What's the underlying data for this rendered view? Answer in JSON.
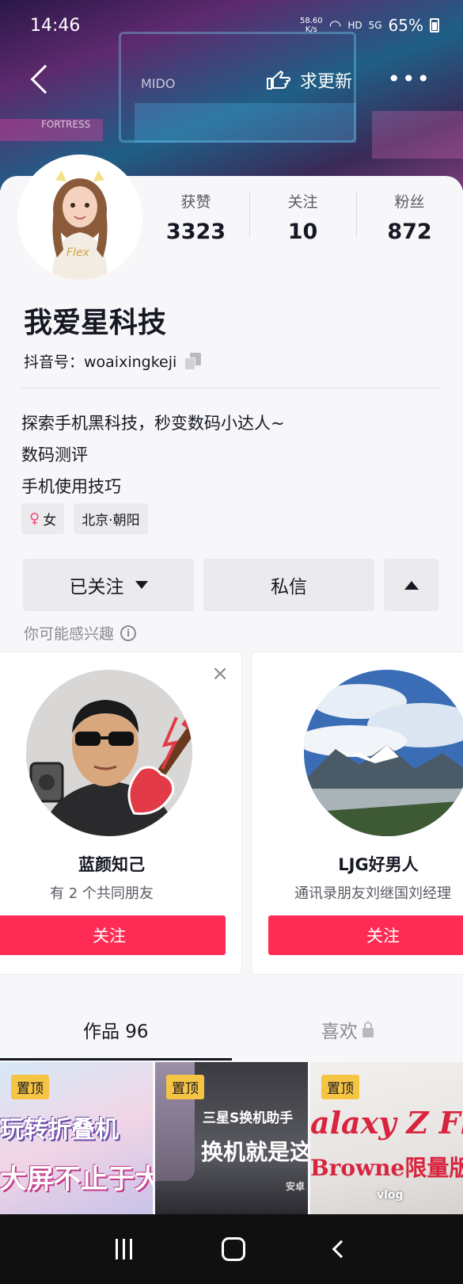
{
  "status_bar": {
    "time": "14:46",
    "net_speed": "58.60\nK/s",
    "hd": "HD",
    "signal": "5G",
    "battery": "65%"
  },
  "nav": {
    "update_label": "求更新",
    "more": "•••"
  },
  "banner_signs": [
    "FORTRESS",
    "MIDO"
  ],
  "stats": [
    {
      "label": "获赞",
      "value": "3323"
    },
    {
      "label": "关注",
      "value": "10"
    },
    {
      "label": "粉丝",
      "value": "872"
    }
  ],
  "profile": {
    "name": "我爱星科技",
    "douyin_id": "抖音号：woaixingkeji",
    "bio": [
      "探索手机黑科技，秒变数码小达人~",
      "数码测评",
      "手机使用技巧"
    ],
    "gender_icon": "♀",
    "gender": "女",
    "location": "北京·朝阳"
  },
  "actions": {
    "follow": "已关注",
    "message": "私信"
  },
  "suggest": {
    "title": "你可能感兴趣",
    "info_icon": "i",
    "close_icon": "×",
    "cards": [
      {
        "name": "蓝颜知己",
        "sub": "有 2 个共同朋友",
        "button": "关注"
      },
      {
        "name": "LJG好男人",
        "sub": "通讯录朋友刘继国刘经理",
        "button": "关注"
      }
    ]
  },
  "tabs": [
    {
      "label": "作品 96"
    },
    {
      "label": "喜欢"
    }
  ],
  "thumbs": [
    {
      "pin": "置顶",
      "line1": "玩转折叠机",
      "line2": "大屏不止于大"
    },
    {
      "pin": "置顶",
      "line1": "三星S换机助手",
      "line2": "换机就是这",
      "line3": "安卓"
    },
    {
      "pin": "置顶",
      "line1": "alaxy Z Fli",
      "line2": "Browne限量版",
      "line3": "vlog"
    }
  ],
  "colors": {
    "accent": "#fe2c55",
    "pin": "#f6c443"
  }
}
